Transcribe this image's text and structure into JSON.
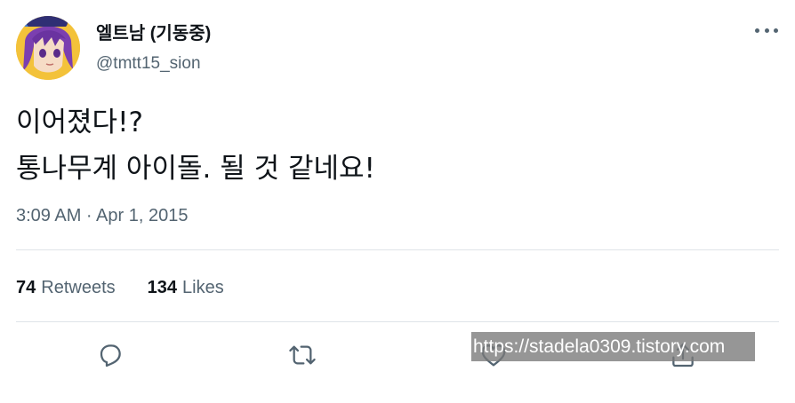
{
  "author": {
    "display_name": "엘트남 (기동중)",
    "handle": "@tmtt15_sion",
    "avatar_icon": "anime-character-avatar"
  },
  "more_icon": "more-dots-icon",
  "tweet": {
    "lines": [
      "이어졌다!?",
      "통나무계 아이돌. 될 것 같네요!"
    ],
    "timestamp": "3:09 AM · Apr 1, 2015"
  },
  "stats": {
    "retweets_count": "74",
    "retweets_label": "Retweets",
    "likes_count": "134",
    "likes_label": "Likes"
  },
  "actions": [
    {
      "name": "reply",
      "icon": "reply-icon"
    },
    {
      "name": "retweet",
      "icon": "retweet-icon"
    },
    {
      "name": "like",
      "icon": "heart-icon"
    },
    {
      "name": "share",
      "icon": "share-icon"
    }
  ],
  "watermark": "https://stadela0309.tistory.com",
  "colors": {
    "text_primary": "#0f1419",
    "text_secondary": "#536471",
    "divider": "#dfe4e8",
    "avatar_bg": "#f3c23a"
  }
}
